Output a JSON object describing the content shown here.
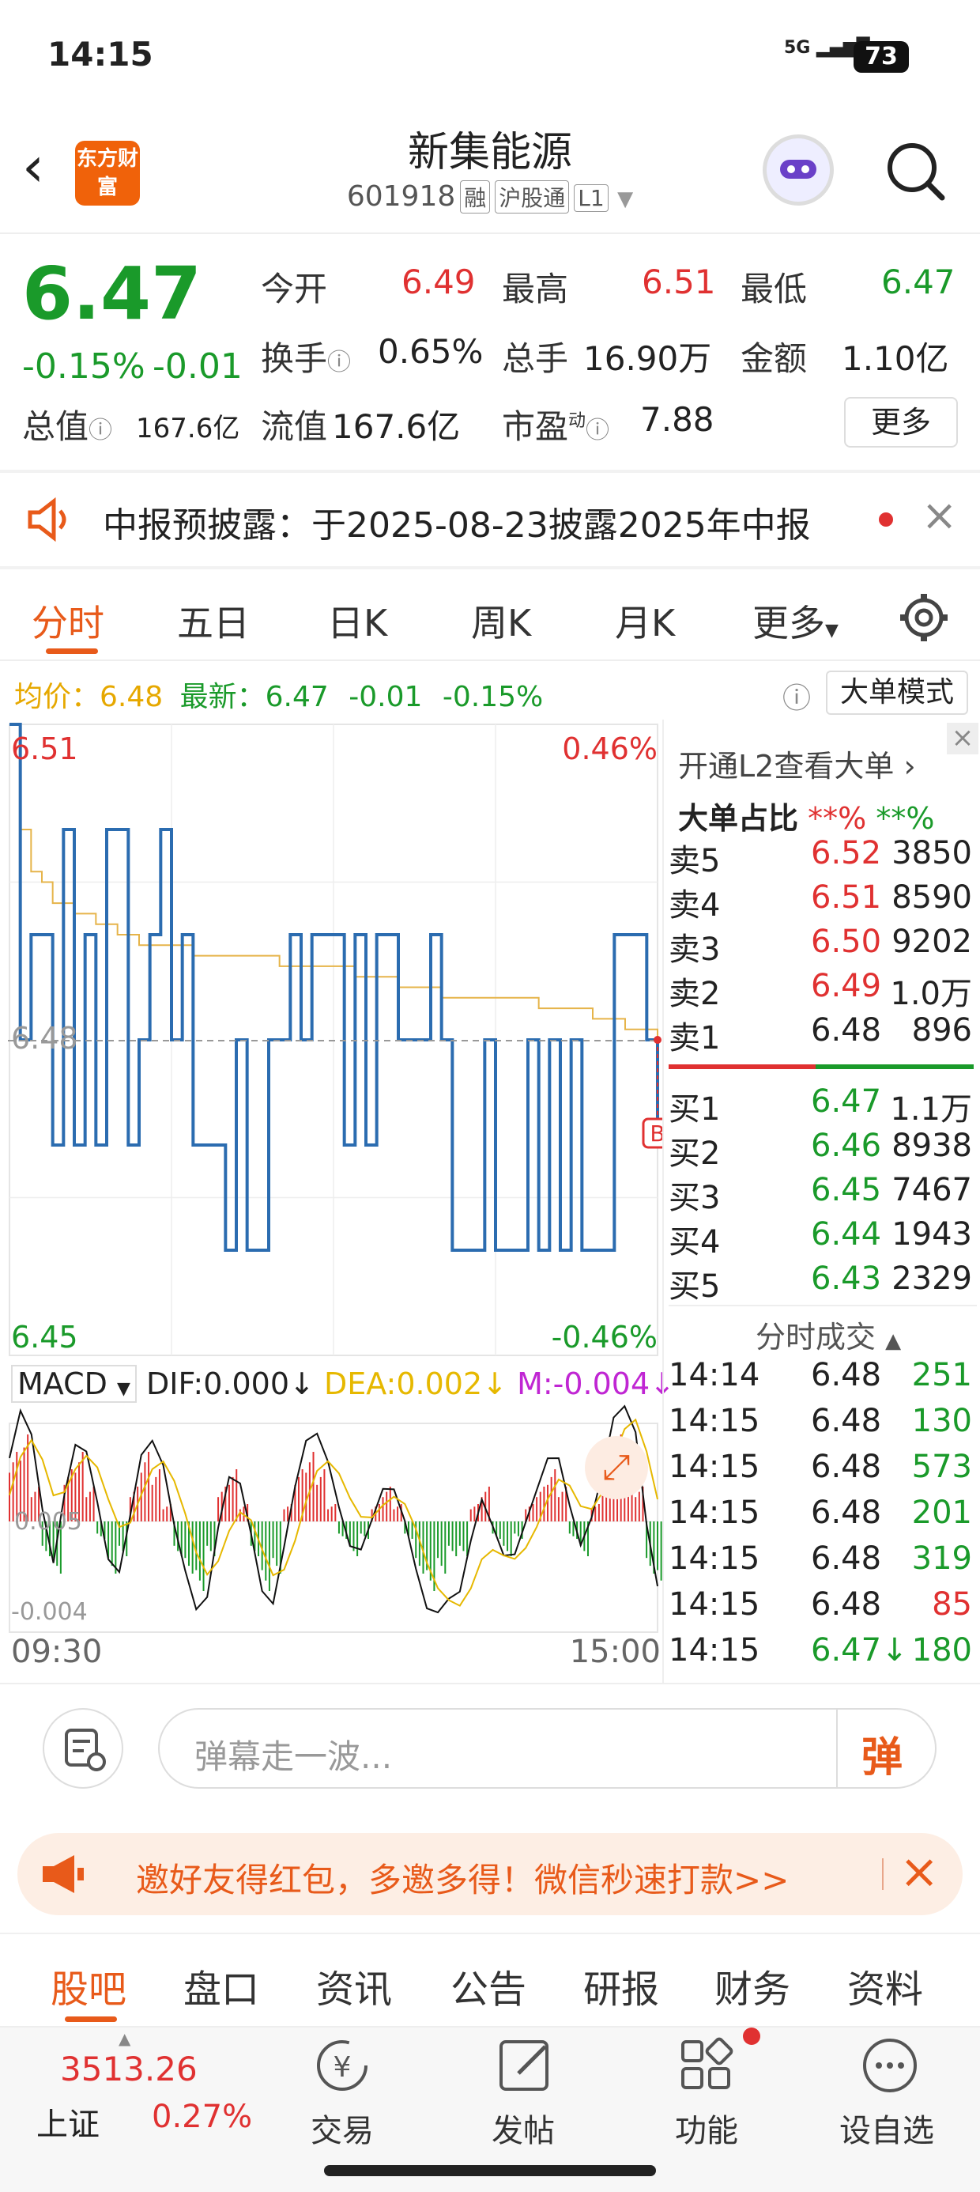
{
  "status": {
    "time": "14:15",
    "network": "5G",
    "battery": "73"
  },
  "header": {
    "title": "新集能源",
    "code": "601918",
    "tags": [
      "融",
      "沪股通",
      "L1"
    ],
    "logo_text": "东方财富"
  },
  "quote": {
    "price": "6.47",
    "change_pct": "-0.15%",
    "change": "-0.01",
    "open_label": "今开",
    "open": "6.49",
    "high_label": "最高",
    "high": "6.51",
    "low_label": "最低",
    "low": "6.47",
    "turnover_label": "换手",
    "turnover": "0.65%",
    "volume_label": "总手",
    "volume": "16.90万",
    "amount_label": "金额",
    "amount": "1.10亿",
    "mktcap_label": "总值",
    "mktcap": "167.6亿",
    "float_label": "流值",
    "float": "167.6亿",
    "pe_label": "市盈",
    "pe_sup": "动",
    "pe": "7.88",
    "more_label": "更多"
  },
  "notice": {
    "text": "中报预披露：于2025-08-23披露2025年中报"
  },
  "ktabs": [
    "分时",
    "五日",
    "日K",
    "周K",
    "月K",
    "更多"
  ],
  "inforow": {
    "avg_label": "均价：",
    "avg": "6.48",
    "latest_label": "最新：",
    "latest": "6.47",
    "chg": "-0.01",
    "pct": "-0.15%",
    "big_order_btn": "大单模式"
  },
  "chart_data": {
    "type": "line",
    "title": "",
    "y_range": [
      6.45,
      6.51
    ],
    "y_labels": {
      "top": "6.51",
      "mid": "6.48",
      "bottom": "6.45"
    },
    "pct_labels": {
      "top": "0.46%",
      "bottom": "-0.46%"
    },
    "x_labels": [
      "09:30",
      "15:00"
    ],
    "series": [
      {
        "values": [
          6.51,
          6.48,
          6.49,
          6.49,
          6.47,
          6.5,
          6.47,
          6.49,
          6.47,
          6.5,
          6.5,
          6.47,
          6.48,
          6.49,
          6.5,
          6.48,
          6.49,
          6.47,
          6.47,
          6.47,
          6.46,
          6.48,
          6.46,
          6.46,
          6.48,
          6.48,
          6.49,
          6.48,
          6.49,
          6.49,
          6.49,
          6.47,
          6.49,
          6.47,
          6.49,
          6.49,
          6.48,
          6.48,
          6.48,
          6.49,
          6.48,
          6.46,
          6.46,
          6.46,
          6.48,
          6.46,
          6.46,
          6.46,
          6.48,
          6.46,
          6.48,
          6.46,
          6.48,
          6.46,
          6.46,
          6.46,
          6.49,
          6.49,
          6.49,
          6.48,
          6.47
        ]
      },
      {
        "values": [
          6.51,
          6.5,
          6.496,
          6.495,
          6.493,
          6.493,
          6.492,
          6.492,
          6.491,
          6.491,
          6.49,
          6.49,
          6.489,
          6.489,
          6.489,
          6.489,
          6.489,
          6.488,
          6.488,
          6.488,
          6.488,
          6.488,
          6.488,
          6.488,
          6.488,
          6.487,
          6.487,
          6.487,
          6.487,
          6.487,
          6.487,
          6.487,
          6.486,
          6.486,
          6.486,
          6.486,
          6.485,
          6.485,
          6.485,
          6.485,
          6.484,
          6.484,
          6.484,
          6.484,
          6.484,
          6.484,
          6.484,
          6.484,
          6.484,
          6.483,
          6.483,
          6.483,
          6.483,
          6.483,
          6.482,
          6.482,
          6.482,
          6.481,
          6.481,
          6.481,
          6.48
        ]
      }
    ],
    "colors": {
      "price": "#2b6cb0",
      "avg": "#e6b44a",
      "up": "#e03131",
      "down": "#1a9a2a"
    }
  },
  "macd": {
    "label": "MACD",
    "dif": "DIF:0.000",
    "dea": "DEA:0.002",
    "m": "M:-0.004",
    "y_top": "0.005",
    "y_bottom": "-0.004",
    "bars": [
      0.004,
      0.005,
      0.002,
      -0.002,
      -0.003,
      0.003,
      0.004,
      0.002,
      -0.001,
      -0.003,
      -0.002,
      0.002,
      0.004,
      0.003,
      0.001,
      -0.002,
      -0.003,
      -0.004,
      -0.002,
      0.002,
      0.003,
      0.001,
      -0.002,
      -0.004,
      -0.003,
      0.001,
      0.003,
      0.004,
      0.003,
      0.001,
      -0.001,
      -0.002,
      -0.001,
      0.001,
      0.002,
      0.001,
      -0.001,
      -0.003,
      -0.004,
      -0.003,
      -0.002,
      -0.002,
      0.001,
      0.002,
      -0.001,
      -0.002,
      -0.001,
      0.001,
      0.002,
      0.003,
      0.002,
      -0.001,
      -0.002,
      0.001,
      0.003,
      0.005,
      0.004,
      0.002,
      -0.003,
      -0.004
    ]
  },
  "orderbook": {
    "open_l2": "开通L2查看大单",
    "big_ratio_label": "大单占比",
    "big_ratio_red": "**%",
    "big_ratio_green": "**%",
    "asks": [
      {
        "label": "卖5",
        "price": "6.52",
        "vol": "3850",
        "color": "red"
      },
      {
        "label": "卖4",
        "price": "6.51",
        "vol": "8590",
        "color": "red"
      },
      {
        "label": "卖3",
        "price": "6.50",
        "vol": "9202",
        "color": "red"
      },
      {
        "label": "卖2",
        "price": "6.49",
        "vol": "1.0万",
        "color": "red"
      },
      {
        "label": "卖1",
        "price": "6.48",
        "vol": "896",
        "color": "black"
      }
    ],
    "bids": [
      {
        "label": "买1",
        "price": "6.47",
        "vol": "1.1万",
        "color": "green"
      },
      {
        "label": "买2",
        "price": "6.46",
        "vol": "8938",
        "color": "green"
      },
      {
        "label": "买3",
        "price": "6.45",
        "vol": "7467",
        "color": "green"
      },
      {
        "label": "买4",
        "price": "6.44",
        "vol": "1943",
        "color": "green"
      },
      {
        "label": "买5",
        "price": "6.43",
        "vol": "2329",
        "color": "green"
      }
    ],
    "trades_title": "分时成交",
    "trades": [
      {
        "time": "14:14",
        "price": "6.48",
        "vol": "251",
        "pcolor": "black",
        "vcolor": "green"
      },
      {
        "time": "14:15",
        "price": "6.48",
        "vol": "130",
        "pcolor": "black",
        "vcolor": "green"
      },
      {
        "time": "14:15",
        "price": "6.48",
        "vol": "573",
        "pcolor": "black",
        "vcolor": "green"
      },
      {
        "time": "14:15",
        "price": "6.48",
        "vol": "201",
        "pcolor": "black",
        "vcolor": "green"
      },
      {
        "time": "14:15",
        "price": "6.48",
        "vol": "319",
        "pcolor": "black",
        "vcolor": "green"
      },
      {
        "time": "14:15",
        "price": "6.48",
        "vol": "85",
        "pcolor": "black",
        "vcolor": "red"
      },
      {
        "time": "14:15",
        "price": "6.47↓",
        "vol": "180",
        "pcolor": "green",
        "vcolor": "green"
      }
    ]
  },
  "danmu": {
    "placeholder": "弹幕走一波...",
    "send": "弹"
  },
  "promo": {
    "text": "邀好友得红包，多邀多得！微信秒速打款>>"
  },
  "bottom_tabs": [
    "股吧",
    "盘口",
    "资讯",
    "公告",
    "研报",
    "财务",
    "资料"
  ],
  "nav": {
    "index_value": "3513.26",
    "index_name": "上证",
    "index_pct": "0.27%",
    "items": [
      "交易",
      "发帖",
      "功能",
      "设自选"
    ]
  }
}
